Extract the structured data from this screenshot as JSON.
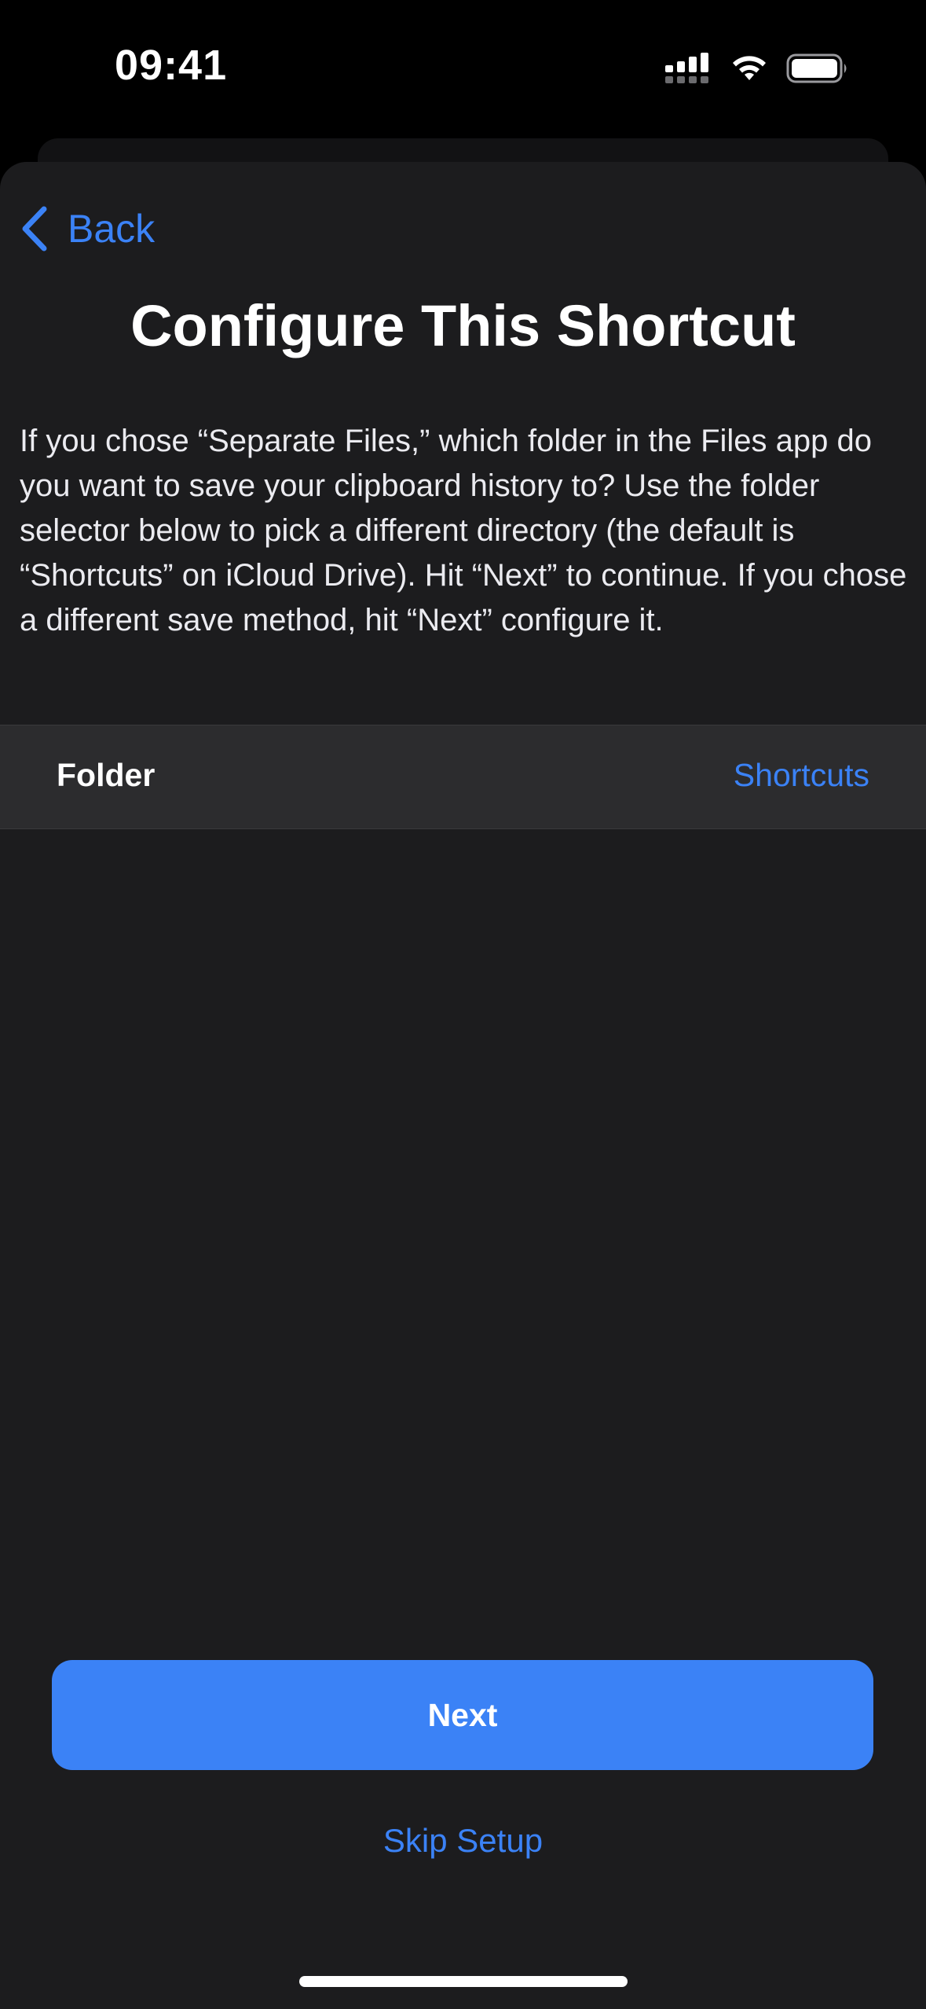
{
  "status_bar": {
    "time": "09:41",
    "icons": [
      "cellular-signal-icon",
      "wifi-icon",
      "battery-icon"
    ]
  },
  "nav": {
    "back_label": "Back",
    "back_icon": "chevron-left-icon"
  },
  "page": {
    "title": "Configure This Shortcut",
    "description": "If you chose “Separate Files,” which folder in the Files app do you want to save your clipboard history to? Use the folder selector below to pick a different directory (the default is “Shortcuts” on iCloud Drive). Hit “Next” to continue. If you chose a different save method, hit “Next” configure it."
  },
  "setting": {
    "label": "Folder",
    "value": "Shortcuts"
  },
  "actions": {
    "next_label": "Next",
    "skip_label": "Skip Setup"
  },
  "colors": {
    "accent": "#3b82f6",
    "sheet_background": "#1c1c1e",
    "row_background": "#2c2c2e",
    "screen_background": "#000000"
  }
}
